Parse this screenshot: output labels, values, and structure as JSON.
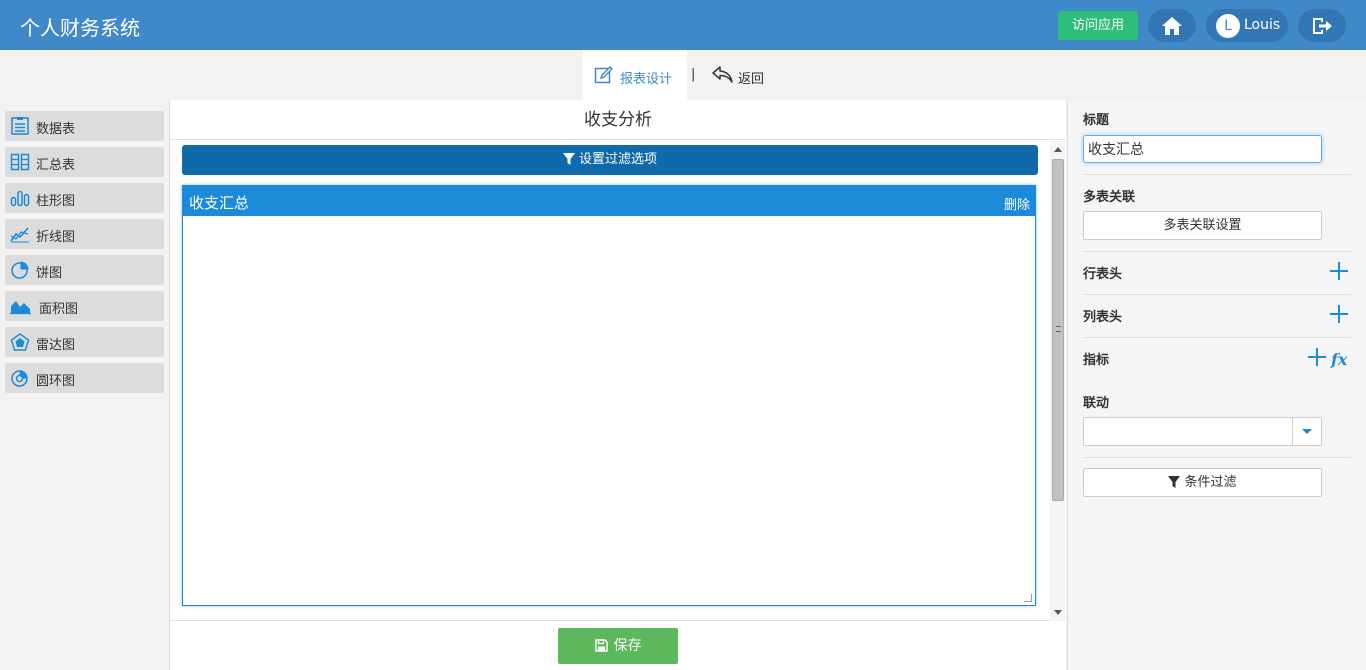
{
  "header": {
    "app_title": "个人财务系统",
    "visit_app_label": "访问应用",
    "user_initial": "L",
    "user_name": "Louis",
    "colors": {
      "header_bg": "#3f89c9",
      "visit_button": "#2dbf79"
    }
  },
  "toolbar": {
    "design_label": "报表设计",
    "separator": "|",
    "back_label": "返回"
  },
  "sidebar": {
    "items": [
      {
        "label": "数据表",
        "icon": "data-table-icon"
      },
      {
        "label": "汇总表",
        "icon": "summary-table-icon"
      },
      {
        "label": "柱形图",
        "icon": "bar-chart-icon"
      },
      {
        "label": "折线图",
        "icon": "line-chart-icon"
      },
      {
        "label": "饼图",
        "icon": "pie-chart-icon"
      },
      {
        "label": "面积图",
        "icon": "area-chart-icon"
      },
      {
        "label": "雷达图",
        "icon": "radar-chart-icon"
      },
      {
        "label": "圆环图",
        "icon": "donut-chart-icon"
      }
    ]
  },
  "center": {
    "title": "收支分析",
    "filter_label": "设置过滤选项",
    "panel": {
      "title": "收支汇总",
      "delete_label": "删除"
    },
    "save_label": "保存"
  },
  "right_panel": {
    "title_label": "标题",
    "title_value": "收支汇总",
    "multi_table_label": "多表关联",
    "multi_table_button": "多表关联设置",
    "row_header_label": "行表头",
    "column_header_label": "列表头",
    "metric_label": "指标",
    "fx_label": "fx",
    "linkage_label": "联动",
    "linkage_value": "",
    "condition_filter_label": "条件过滤"
  }
}
